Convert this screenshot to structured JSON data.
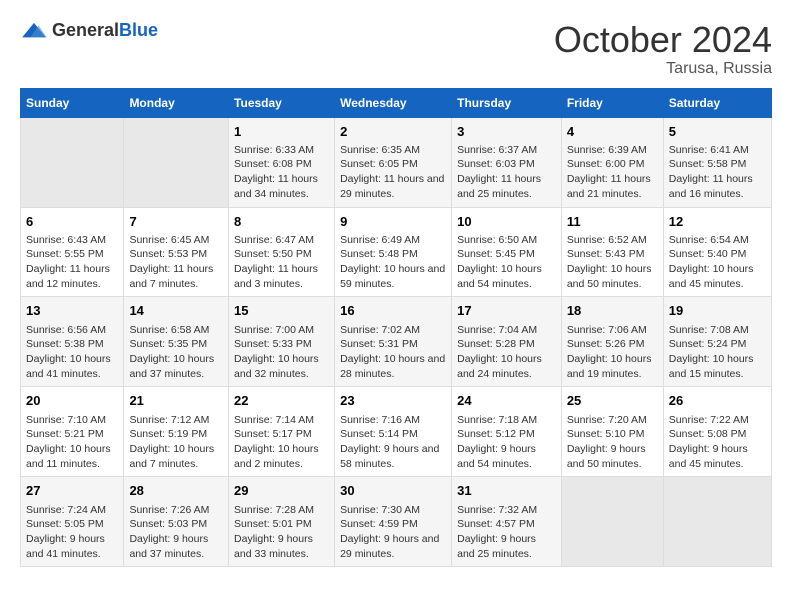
{
  "logo": {
    "general": "General",
    "blue": "Blue"
  },
  "title": "October 2024",
  "subtitle": "Tarusa, Russia",
  "weekdays": [
    "Sunday",
    "Monday",
    "Tuesday",
    "Wednesday",
    "Thursday",
    "Friday",
    "Saturday"
  ],
  "weeks": [
    [
      {
        "day": "",
        "sunrise": "",
        "sunset": "",
        "daylight": ""
      },
      {
        "day": "",
        "sunrise": "",
        "sunset": "",
        "daylight": ""
      },
      {
        "day": "1",
        "sunrise": "Sunrise: 6:33 AM",
        "sunset": "Sunset: 6:08 PM",
        "daylight": "Daylight: 11 hours and 34 minutes."
      },
      {
        "day": "2",
        "sunrise": "Sunrise: 6:35 AM",
        "sunset": "Sunset: 6:05 PM",
        "daylight": "Daylight: 11 hours and 29 minutes."
      },
      {
        "day": "3",
        "sunrise": "Sunrise: 6:37 AM",
        "sunset": "Sunset: 6:03 PM",
        "daylight": "Daylight: 11 hours and 25 minutes."
      },
      {
        "day": "4",
        "sunrise": "Sunrise: 6:39 AM",
        "sunset": "Sunset: 6:00 PM",
        "daylight": "Daylight: 11 hours and 21 minutes."
      },
      {
        "day": "5",
        "sunrise": "Sunrise: 6:41 AM",
        "sunset": "Sunset: 5:58 PM",
        "daylight": "Daylight: 11 hours and 16 minutes."
      }
    ],
    [
      {
        "day": "6",
        "sunrise": "Sunrise: 6:43 AM",
        "sunset": "Sunset: 5:55 PM",
        "daylight": "Daylight: 11 hours and 12 minutes."
      },
      {
        "day": "7",
        "sunrise": "Sunrise: 6:45 AM",
        "sunset": "Sunset: 5:53 PM",
        "daylight": "Daylight: 11 hours and 7 minutes."
      },
      {
        "day": "8",
        "sunrise": "Sunrise: 6:47 AM",
        "sunset": "Sunset: 5:50 PM",
        "daylight": "Daylight: 11 hours and 3 minutes."
      },
      {
        "day": "9",
        "sunrise": "Sunrise: 6:49 AM",
        "sunset": "Sunset: 5:48 PM",
        "daylight": "Daylight: 10 hours and 59 minutes."
      },
      {
        "day": "10",
        "sunrise": "Sunrise: 6:50 AM",
        "sunset": "Sunset: 5:45 PM",
        "daylight": "Daylight: 10 hours and 54 minutes."
      },
      {
        "day": "11",
        "sunrise": "Sunrise: 6:52 AM",
        "sunset": "Sunset: 5:43 PM",
        "daylight": "Daylight: 10 hours and 50 minutes."
      },
      {
        "day": "12",
        "sunrise": "Sunrise: 6:54 AM",
        "sunset": "Sunset: 5:40 PM",
        "daylight": "Daylight: 10 hours and 45 minutes."
      }
    ],
    [
      {
        "day": "13",
        "sunrise": "Sunrise: 6:56 AM",
        "sunset": "Sunset: 5:38 PM",
        "daylight": "Daylight: 10 hours and 41 minutes."
      },
      {
        "day": "14",
        "sunrise": "Sunrise: 6:58 AM",
        "sunset": "Sunset: 5:35 PM",
        "daylight": "Daylight: 10 hours and 37 minutes."
      },
      {
        "day": "15",
        "sunrise": "Sunrise: 7:00 AM",
        "sunset": "Sunset: 5:33 PM",
        "daylight": "Daylight: 10 hours and 32 minutes."
      },
      {
        "day": "16",
        "sunrise": "Sunrise: 7:02 AM",
        "sunset": "Sunset: 5:31 PM",
        "daylight": "Daylight: 10 hours and 28 minutes."
      },
      {
        "day": "17",
        "sunrise": "Sunrise: 7:04 AM",
        "sunset": "Sunset: 5:28 PM",
        "daylight": "Daylight: 10 hours and 24 minutes."
      },
      {
        "day": "18",
        "sunrise": "Sunrise: 7:06 AM",
        "sunset": "Sunset: 5:26 PM",
        "daylight": "Daylight: 10 hours and 19 minutes."
      },
      {
        "day": "19",
        "sunrise": "Sunrise: 7:08 AM",
        "sunset": "Sunset: 5:24 PM",
        "daylight": "Daylight: 10 hours and 15 minutes."
      }
    ],
    [
      {
        "day": "20",
        "sunrise": "Sunrise: 7:10 AM",
        "sunset": "Sunset: 5:21 PM",
        "daylight": "Daylight: 10 hours and 11 minutes."
      },
      {
        "day": "21",
        "sunrise": "Sunrise: 7:12 AM",
        "sunset": "Sunset: 5:19 PM",
        "daylight": "Daylight: 10 hours and 7 minutes."
      },
      {
        "day": "22",
        "sunrise": "Sunrise: 7:14 AM",
        "sunset": "Sunset: 5:17 PM",
        "daylight": "Daylight: 10 hours and 2 minutes."
      },
      {
        "day": "23",
        "sunrise": "Sunrise: 7:16 AM",
        "sunset": "Sunset: 5:14 PM",
        "daylight": "Daylight: 9 hours and 58 minutes."
      },
      {
        "day": "24",
        "sunrise": "Sunrise: 7:18 AM",
        "sunset": "Sunset: 5:12 PM",
        "daylight": "Daylight: 9 hours and 54 minutes."
      },
      {
        "day": "25",
        "sunrise": "Sunrise: 7:20 AM",
        "sunset": "Sunset: 5:10 PM",
        "daylight": "Daylight: 9 hours and 50 minutes."
      },
      {
        "day": "26",
        "sunrise": "Sunrise: 7:22 AM",
        "sunset": "Sunset: 5:08 PM",
        "daylight": "Daylight: 9 hours and 45 minutes."
      }
    ],
    [
      {
        "day": "27",
        "sunrise": "Sunrise: 7:24 AM",
        "sunset": "Sunset: 5:05 PM",
        "daylight": "Daylight: 9 hours and 41 minutes."
      },
      {
        "day": "28",
        "sunrise": "Sunrise: 7:26 AM",
        "sunset": "Sunset: 5:03 PM",
        "daylight": "Daylight: 9 hours and 37 minutes."
      },
      {
        "day": "29",
        "sunrise": "Sunrise: 7:28 AM",
        "sunset": "Sunset: 5:01 PM",
        "daylight": "Daylight: 9 hours and 33 minutes."
      },
      {
        "day": "30",
        "sunrise": "Sunrise: 7:30 AM",
        "sunset": "Sunset: 4:59 PM",
        "daylight": "Daylight: 9 hours and 29 minutes."
      },
      {
        "day": "31",
        "sunrise": "Sunrise: 7:32 AM",
        "sunset": "Sunset: 4:57 PM",
        "daylight": "Daylight: 9 hours and 25 minutes."
      },
      {
        "day": "",
        "sunrise": "",
        "sunset": "",
        "daylight": ""
      },
      {
        "day": "",
        "sunrise": "",
        "sunset": "",
        "daylight": ""
      }
    ]
  ]
}
